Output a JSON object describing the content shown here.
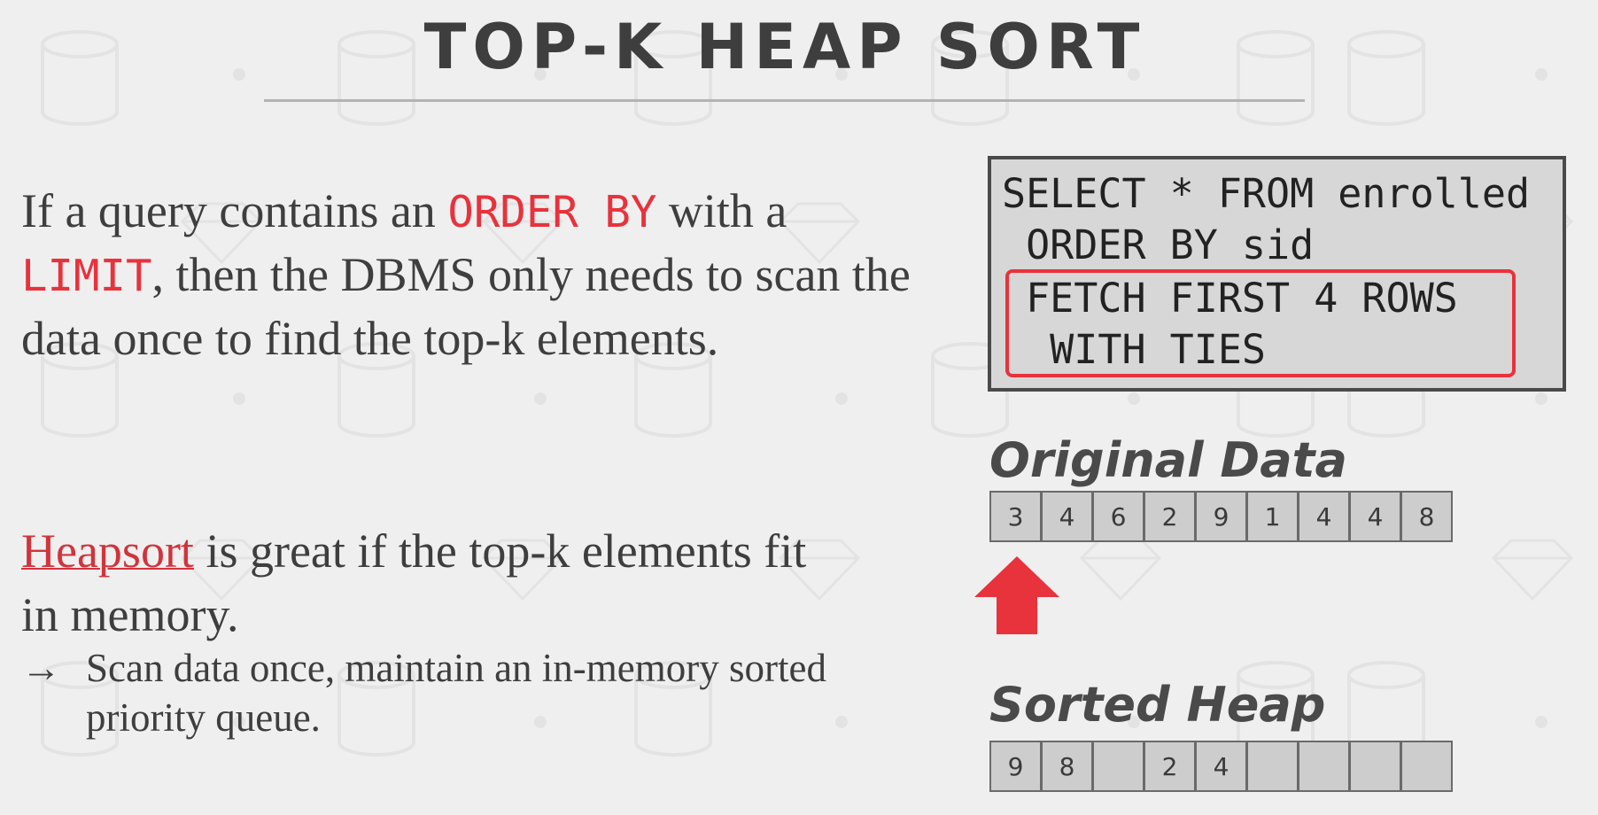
{
  "slide": {
    "title": "TOP-K HEAP SORT"
  },
  "intro": {
    "part1": "If a query contains an ",
    "keyword1": "ORDER BY",
    "part2": " with a ",
    "keyword2": "LIMIT",
    "part3": ", then the DBMS only needs to scan the data once to find the top-k elements."
  },
  "heapsort": {
    "link_text": "Heapsort",
    "rest": " is great if  the top-k elements fit in memory.",
    "bullet_arrow": "→",
    "bullet_text": "Scan data once, maintain an in-memory sorted priority queue."
  },
  "sql": {
    "line1": "SELECT * FROM enrolled",
    "line2": " ORDER BY sid",
    "line3": " FETCH FIRST 4 ROWS",
    "line4": "  WITH TIES"
  },
  "original_data": {
    "label": "Original Data",
    "values": [
      "3",
      "4",
      "6",
      "2",
      "9",
      "1",
      "4",
      "4",
      "8"
    ]
  },
  "sorted_heap": {
    "label": "Sorted Heap",
    "cells": [
      "9",
      "8",
      "",
      "2",
      "4",
      "",
      "",
      "",
      ""
    ]
  },
  "colors": {
    "accent": "#e8323c",
    "text": "#3e3e3e",
    "background": "#efefef",
    "cell_fill": "#cdcdcd"
  }
}
